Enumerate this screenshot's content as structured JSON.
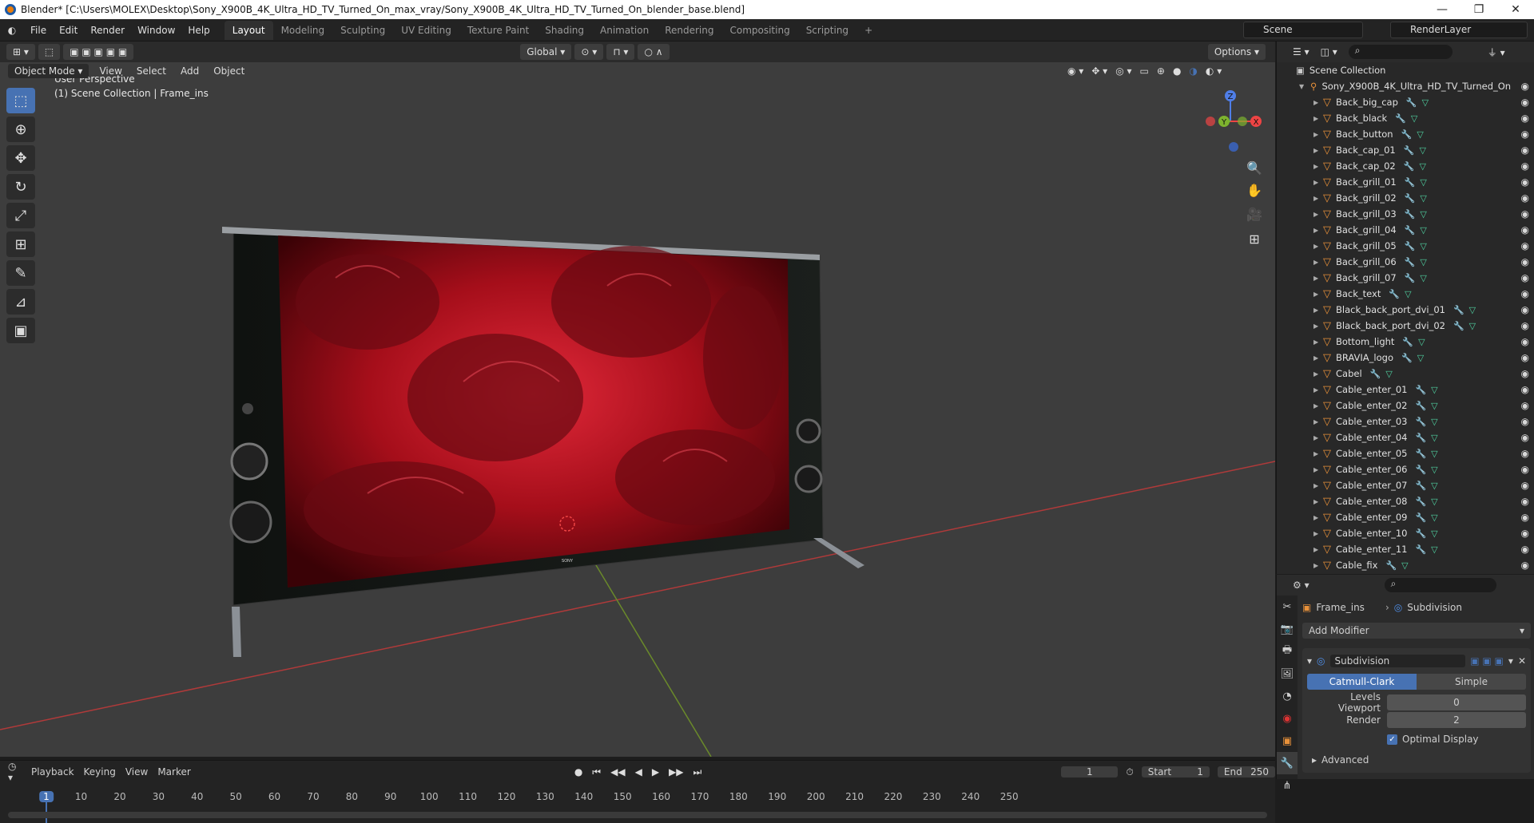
{
  "window": {
    "title": "Blender* [C:\\Users\\MOLEX\\Desktop\\Sony_X900B_4K_Ultra_HD_TV_Turned_On_max_vray/Sony_X900B_4K_Ultra_HD_TV_Turned_On_blender_base.blend]",
    "min": "—",
    "max": "❐",
    "close": "✕"
  },
  "menu": [
    "File",
    "Edit",
    "Render",
    "Window",
    "Help"
  ],
  "workspaces": [
    {
      "label": "Layout",
      "active": true
    },
    {
      "label": "Modeling"
    },
    {
      "label": "Sculpting"
    },
    {
      "label": "UV Editing"
    },
    {
      "label": "Texture Paint"
    },
    {
      "label": "Shading"
    },
    {
      "label": "Animation"
    },
    {
      "label": "Rendering"
    },
    {
      "label": "Compositing"
    },
    {
      "label": "Scripting"
    },
    {
      "label": "+"
    }
  ],
  "scene": "Scene",
  "renderlayer": "RenderLayer",
  "header": {
    "transform_orientation": "Global",
    "options": "Options"
  },
  "viewport_menu": {
    "mode": "Object Mode",
    "items": [
      "View",
      "Select",
      "Add",
      "Object"
    ]
  },
  "viewport_text": {
    "line1": "User Perspective",
    "line2": "(1) Scene Collection | Frame_ins"
  },
  "gizmo": {
    "z": "Z",
    "y": "Y",
    "x": "X"
  },
  "outliner": {
    "root": "Scene Collection",
    "collection": "Sony_X900B_4K_Ultra_HD_TV_Turned_On",
    "items": [
      "Back_big_cap",
      "Back_black",
      "Back_button",
      "Back_cap_01",
      "Back_cap_02",
      "Back_grill_01",
      "Back_grill_02",
      "Back_grill_03",
      "Back_grill_04",
      "Back_grill_05",
      "Back_grill_06",
      "Back_grill_07",
      "Back_text",
      "Black_back_port_dvi_01",
      "Black_back_port_dvi_02",
      "Bottom_light",
      "BRAVIA_logo",
      "Cabel",
      "Cable_enter_01",
      "Cable_enter_02",
      "Cable_enter_03",
      "Cable_enter_04",
      "Cable_enter_05",
      "Cable_enter_06",
      "Cable_enter_07",
      "Cable_enter_08",
      "Cable_enter_09",
      "Cable_enter_10",
      "Cable_enter_11",
      "Cable_fix"
    ]
  },
  "properties": {
    "object": "Frame_ins",
    "modifier_context": "Subdivision",
    "add_modifier": "Add Modifier",
    "modifier_name": "Subdivision",
    "mode_a": "Catmull-Clark",
    "mode_b": "Simple",
    "levels_viewport_label": "Levels Viewport",
    "levels_viewport": "0",
    "render_label": "Render",
    "render": "2",
    "optimal_display": "Optimal Display",
    "advanced": "Advanced"
  },
  "timeline": {
    "menus": [
      "Playback",
      "Keying",
      "View",
      "Marker"
    ],
    "current_frame": "1",
    "start_label": "Start",
    "start": "1",
    "end_label": "End",
    "end": "250",
    "ruler": [
      "1",
      "10",
      "20",
      "30",
      "40",
      "50",
      "60",
      "70",
      "80",
      "90",
      "100",
      "110",
      "120",
      "130",
      "140",
      "150",
      "160",
      "170",
      "180",
      "190",
      "200",
      "210",
      "220",
      "230",
      "240",
      "250"
    ]
  },
  "tv_logo": "SONY",
  "colors": {
    "accent": "#4772b3",
    "mesh_icon": "#e8913a",
    "rose": "#b0101c",
    "red_axis": "#b03a3a",
    "green_axis": "#6a8a2a"
  }
}
